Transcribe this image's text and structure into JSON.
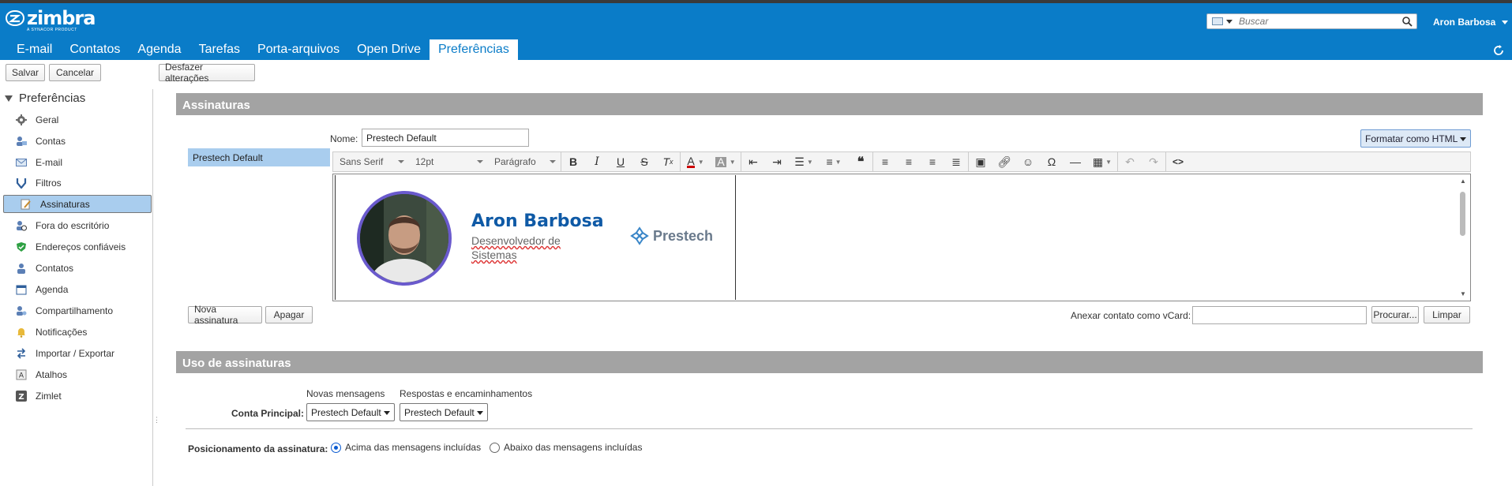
{
  "app": {
    "logo_text": "zimbra",
    "logo_sub": "A SYNACOR PRODUCT"
  },
  "header": {
    "search_placeholder": "Buscar",
    "user": "Aron Barbosa",
    "tabs": [
      {
        "label": "E-mail"
      },
      {
        "label": "Contatos"
      },
      {
        "label": "Agenda"
      },
      {
        "label": "Tarefas"
      },
      {
        "label": "Porta-arquivos"
      },
      {
        "label": "Open Drive"
      },
      {
        "label": "Preferências",
        "active": true
      }
    ]
  },
  "toolbar": {
    "save": "Salvar",
    "cancel": "Cancelar",
    "undo": "Desfazer alterações"
  },
  "sidebar": {
    "title": "Preferências",
    "items": [
      {
        "label": "Geral",
        "icon": "gear-icon"
      },
      {
        "label": "Contas",
        "icon": "accounts-icon"
      },
      {
        "label": "E-mail",
        "icon": "mail-icon"
      },
      {
        "label": "Filtros",
        "icon": "filter-icon"
      },
      {
        "label": "Assinaturas",
        "icon": "signature-icon",
        "selected": true
      },
      {
        "label": "Fora do escritório",
        "icon": "out-of-office-icon"
      },
      {
        "label": "Endereços confiáveis",
        "icon": "shield-icon"
      },
      {
        "label": "Contatos",
        "icon": "contact-icon"
      },
      {
        "label": "Agenda",
        "icon": "calendar-icon"
      },
      {
        "label": "Compartilhamento",
        "icon": "share-icon"
      },
      {
        "label": "Notificações",
        "icon": "bell-icon"
      },
      {
        "label": "Importar / Exportar",
        "icon": "import-export-icon"
      },
      {
        "label": "Atalhos",
        "icon": "shortcut-icon"
      },
      {
        "label": "Zimlet",
        "icon": "zimlet-icon"
      }
    ]
  },
  "signatures": {
    "section_title": "Assinaturas",
    "list": [
      "Prestech Default"
    ],
    "name_label": "Nome:",
    "name_value": "Prestech Default",
    "format_button": "Formatar como HTML",
    "editor_toolbar": {
      "font": "Sans Serif",
      "size": "12pt",
      "block": "Parágrafo"
    },
    "signature": {
      "name": "Aron Barbosa",
      "role": "Desenvolvedor de Sistemas",
      "company": "Prestech"
    },
    "new_button": "Nova assinatura",
    "delete_button": "Apagar",
    "vcard_label": "Anexar contato como vCard:",
    "browse_button": "Procurar...",
    "clear_button": "Limpar"
  },
  "usage": {
    "section_title": "Uso de assinaturas",
    "col_new": "Novas mensagens",
    "col_reply": "Respostas e encaminhamentos",
    "account_label": "Conta Principal:",
    "new_value": "Prestech Default",
    "reply_value": "Prestech Default",
    "position_label": "Posicionamento da assinatura:",
    "position_above": "Acima das mensagens incluídas",
    "position_below": "Abaixo das mensagens incluídas",
    "position_selected": "above"
  },
  "colors": {
    "brand": "#0a7cc8",
    "selected": "#a9cdee",
    "section": "#a3a3a3",
    "name": "#0f5aa6"
  }
}
